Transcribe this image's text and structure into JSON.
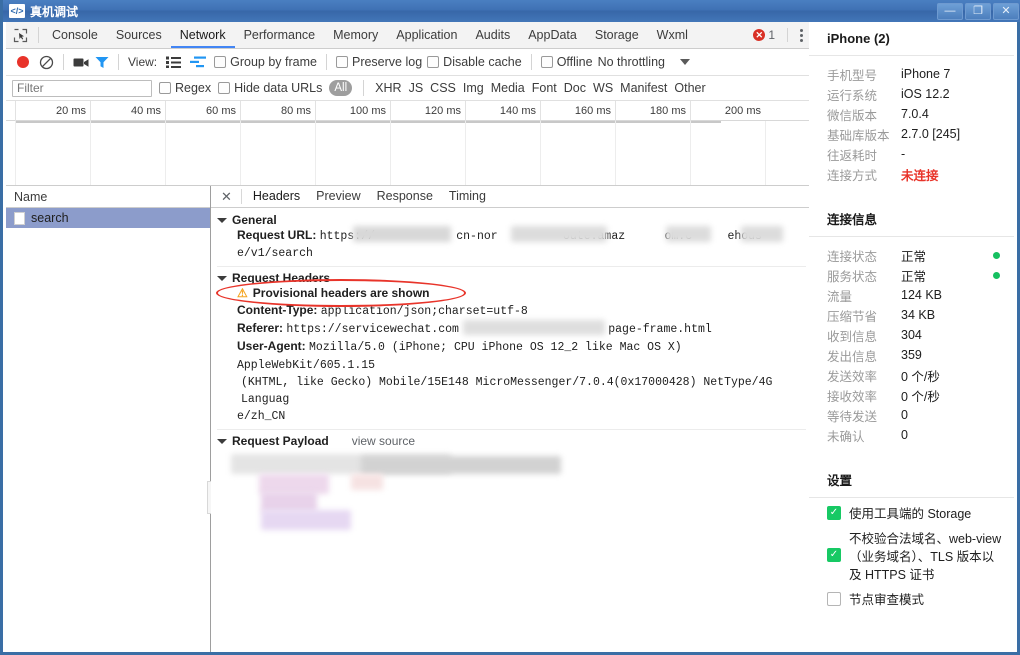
{
  "window": {
    "title": "真机调试",
    "icon": "code-icon",
    "minimize": "—",
    "maximize": "❐",
    "close": "✕"
  },
  "devtools": {
    "inspect_icon": "inspect-cursor-icon",
    "tabs": [
      {
        "label": "Console",
        "active": false
      },
      {
        "label": "Sources",
        "active": false
      },
      {
        "label": "Network",
        "active": true
      },
      {
        "label": "Performance",
        "active": false
      },
      {
        "label": "Memory",
        "active": false
      },
      {
        "label": "Application",
        "active": false
      },
      {
        "label": "Audits",
        "active": false
      },
      {
        "label": "AppData",
        "active": false
      },
      {
        "label": "Storage",
        "active": false
      },
      {
        "label": "Wxml",
        "active": false
      }
    ],
    "error_count": "1",
    "more_menu": "kebab-menu-icon",
    "toolbar": {
      "record_icon": "record-button",
      "clear_icon": "clear-icon",
      "camera_icon": "camera-icon",
      "filter_icon": "filter-funnel-icon",
      "view_label": "View:",
      "view_list_icon": "list-view-icon",
      "view_timeline_icon": "timeline-view-icon",
      "group_by_frame": "Group by frame",
      "preserve_log": "Preserve log",
      "disable_cache": "Disable cache",
      "offline": "Offline",
      "throttling": "No throttling"
    },
    "filterbar": {
      "filter_placeholder": "Filter",
      "filter_value": "",
      "regex": "Regex",
      "hide_data_urls": "Hide data URLs",
      "all_pill": "All",
      "types": [
        "XHR",
        "JS",
        "CSS",
        "Img",
        "Media",
        "Font",
        "Doc",
        "WS",
        "Manifest",
        "Other"
      ]
    },
    "timeline": {
      "ticks": [
        "20 ms",
        "40 ms",
        "60 ms",
        "80 ms",
        "100 ms",
        "120 ms",
        "140 ms",
        "160 ms",
        "180 ms",
        "200 ms"
      ]
    },
    "requests": {
      "column_header": "Name",
      "rows": [
        {
          "name": "search",
          "selected": true
        }
      ]
    },
    "detail": {
      "close_label": "✕",
      "tabs": [
        {
          "label": "Headers",
          "active": true
        },
        {
          "label": "Preview",
          "active": false
        },
        {
          "label": "Response",
          "active": false
        },
        {
          "label": "Timing",
          "active": false
        }
      ],
      "general": {
        "title": "General",
        "request_url_key": "Request URL:",
        "request_url_prefix": "https://",
        "request_url_frag1": "cn-nor",
        "request_url_frag2": "oute.amaz",
        "request_url_frag3": "om.c",
        "request_url_frag4": "ehous",
        "request_url_line2": "e/v1/search"
      },
      "request_headers": {
        "title": "Request Headers",
        "warning": "Provisional headers are shown",
        "warning_icon": "warning-triangle-icon",
        "content_type_key": "Content-Type:",
        "content_type_value": "application/json;charset=utf-8",
        "referer_key": "Referer:",
        "referer_value": "https://servicewechat.com",
        "referer_tail": "page-frame.html",
        "user_agent_key": "User-Agent:",
        "user_agent_line1": "Mozilla/5.0 (iPhone; CPU iPhone OS 12_2 like Mac OS X) AppleWebKit/605.1.15",
        "user_agent_line2": "(KHTML, like Gecko) Mobile/15E148 MicroMessenger/7.0.4(0x17000428) NetType/4G Languag",
        "user_agent_line3": "e/zh_CN"
      },
      "request_payload": {
        "title": "Request Payload",
        "view_source": "view source"
      }
    }
  },
  "device_panel": {
    "title": "iPhone (2)",
    "device_info": [
      {
        "key": "手机型号",
        "value": "iPhone 7",
        "status": null
      },
      {
        "key": "运行系统",
        "value": "iOS 12.2",
        "status": null
      },
      {
        "key": "微信版本",
        "value": "7.0.4",
        "status": null
      },
      {
        "key": "基础库版本",
        "value": "2.7.0 [245]",
        "status": null
      },
      {
        "key": "往返耗时",
        "value": "-",
        "status": null
      },
      {
        "key": "连接方式",
        "value": "未连接",
        "status": "red"
      }
    ],
    "connection_title": "连接信息",
    "connection_info": [
      {
        "key": "连接状态",
        "value": "正常",
        "dot": true
      },
      {
        "key": "服务状态",
        "value": "正常",
        "dot": true
      },
      {
        "key": "流量",
        "value": "124 KB",
        "dot": false
      },
      {
        "key": "压缩节省",
        "value": "34 KB",
        "dot": false
      },
      {
        "key": "收到信息",
        "value": "304",
        "dot": false
      },
      {
        "key": "发出信息",
        "value": "359",
        "dot": false
      },
      {
        "key": "发送效率",
        "value": "0 个/秒",
        "dot": false
      },
      {
        "key": "接收效率",
        "value": "0 个/秒",
        "dot": false
      },
      {
        "key": "等待发送",
        "value": "0",
        "dot": false
      },
      {
        "key": "未确认",
        "value": "0",
        "dot": false
      }
    ],
    "settings_title": "设置",
    "settings": [
      {
        "label": "使用工具端的 Storage",
        "checked": true
      },
      {
        "label": "不校验合法域名、web-view（业务域名）、TLS 版本以及 HTTPS 证书",
        "checked": true
      },
      {
        "label": "节点审查模式",
        "checked": false
      }
    ]
  },
  "colors": {
    "accent": "#4285f4",
    "error": "#d93025",
    "ok_green": "#16c060",
    "annotation_red": "#e8342a",
    "selected_row": "#8c9ccb"
  }
}
